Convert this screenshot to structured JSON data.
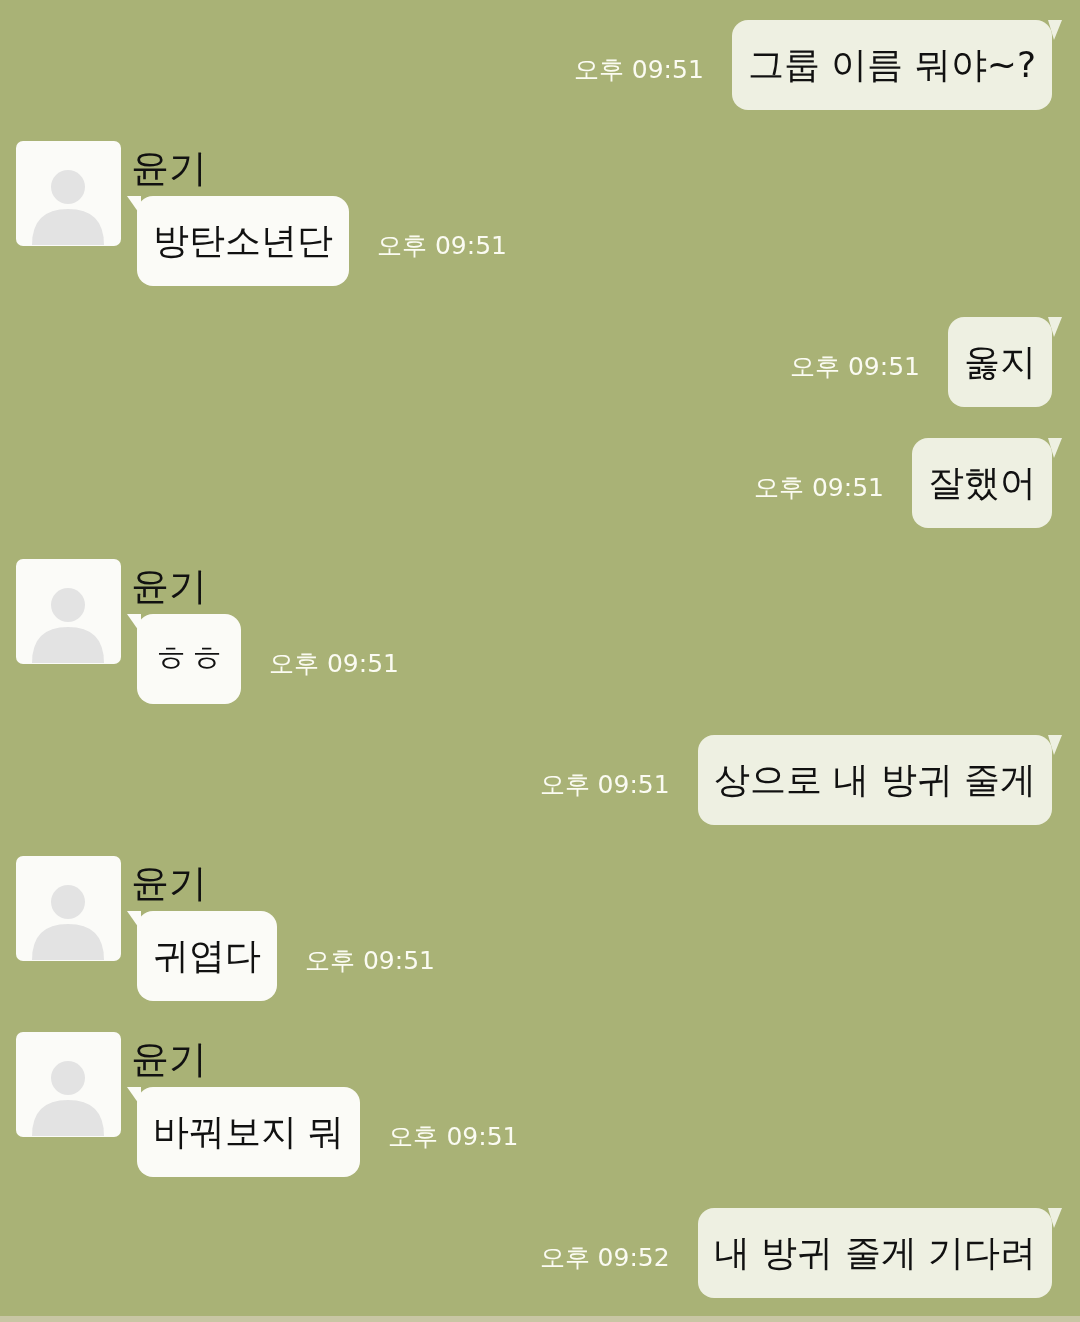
{
  "messages": [
    {
      "kind": "sent",
      "text": "그룹 이름 뭐야~?",
      "time": "오후 09:51"
    },
    {
      "kind": "received",
      "sender": "윤기",
      "text": "방탄소년단",
      "time": "오후 09:51"
    },
    {
      "kind": "sent",
      "text": "옳지",
      "time": "오후 09:51"
    },
    {
      "kind": "sent",
      "text": "잘했어",
      "time": "오후 09:51"
    },
    {
      "kind": "received",
      "sender": "윤기",
      "text": "ㅎㅎ",
      "time": "오후 09:51"
    },
    {
      "kind": "sent",
      "text": "상으로 내 방귀 줄게",
      "time": "오후 09:51"
    },
    {
      "kind": "received",
      "sender": "윤기",
      "text": "귀엽다",
      "time": "오후 09:51"
    },
    {
      "kind": "received",
      "sender": "윤기",
      "text": "바꿔보지 뭐",
      "time": "오후 09:51"
    },
    {
      "kind": "sent",
      "text": "내 방귀 줄게 기다려",
      "time": "오후 09:52"
    }
  ]
}
